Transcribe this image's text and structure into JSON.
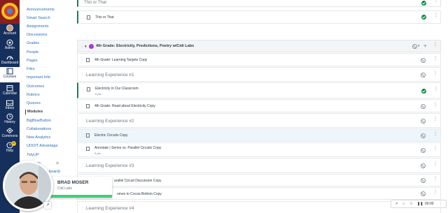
{
  "global_nav": {
    "items": [
      {
        "label": "Account",
        "icon": "account-icon"
      },
      {
        "label": "Admin",
        "icon": "admin-icon"
      },
      {
        "label": "Dashboard",
        "icon": "dashboard-icon"
      },
      {
        "label": "Courses",
        "icon": "courses-icon"
      },
      {
        "label": "Calendar",
        "icon": "calendar-icon"
      },
      {
        "label": "Inbox",
        "icon": "inbox-icon"
      },
      {
        "label": "History",
        "icon": "history-icon"
      },
      {
        "label": "Commons",
        "icon": "commons-icon"
      },
      {
        "label": "Help",
        "icon": "help-icon"
      }
    ],
    "help_badge": "10"
  },
  "course_nav": {
    "items": [
      "Announcements",
      "Smart Search",
      "Assignments",
      "Discussions",
      "Grades",
      "People",
      "Pages",
      "Files",
      "Important Info",
      "Outcomes",
      "Rubrics",
      "Quizzes",
      "Modules",
      "BigBlueButton",
      "Collaborations",
      "New Analytics",
      "UDOIT Advantage",
      "TidyUP"
    ],
    "active": "Modules",
    "partial_items": [
      "ge",
      "board)"
    ]
  },
  "modules": {
    "top_header": "This or That",
    "top_item": "This or That",
    "module": {
      "title": "4th Grade: Electricity, Predictions, Poetry w/Cidi Labs"
    },
    "rows": [
      {
        "kind": "item",
        "title": "4th Grade: Learning Targets Copy"
      },
      {
        "kind": "header",
        "title": "Learning Experience #1"
      },
      {
        "kind": "item",
        "title": "Electricity in Our Classroom",
        "sub": "0 pts",
        "done": true
      },
      {
        "kind": "item",
        "title": "4th Grade: Read about Electricity Copy"
      },
      {
        "kind": "header",
        "title": "Learning Experience #2"
      },
      {
        "kind": "item",
        "title": "Electric Circuits Copy"
      },
      {
        "kind": "item",
        "title": "Annotate | Series vs. Parallel Circuits Copy",
        "sub": "0 pts"
      },
      {
        "kind": "header",
        "title": "Learning Experience #3"
      },
      {
        "kind": "item",
        "title": "arallel Circuit Discussion Copy"
      },
      {
        "kind": "item",
        "title": "omes to Cocoa Bottom Copy"
      },
      {
        "kind": "header",
        "title": "Learning Experience #4"
      }
    ]
  },
  "presenter": {
    "name": "BRAD MOSER",
    "org": "Cidi Labs"
  },
  "recorder": {
    "time": "00:00"
  },
  "colors": {
    "nav_bg": "#16305d",
    "link": "#2a6ebb",
    "success": "#0b874b",
    "presenter_bar": "#3ecf7a"
  }
}
